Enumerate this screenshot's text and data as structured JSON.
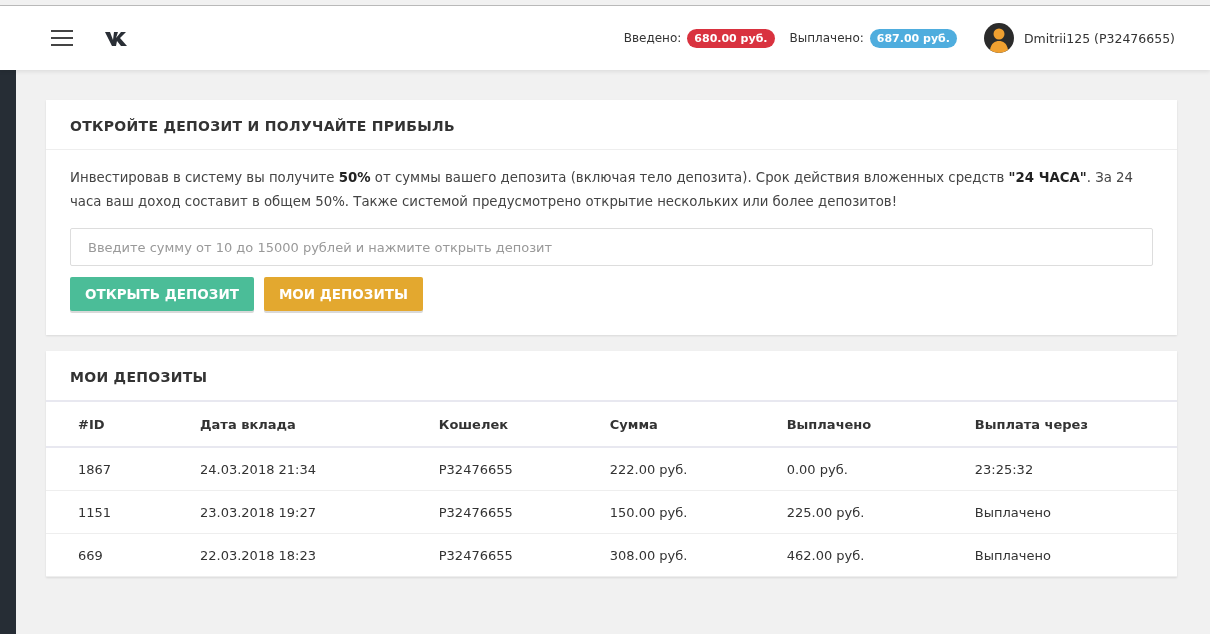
{
  "header": {
    "stats": [
      {
        "label": "Введено:",
        "value": "680.00 руб.",
        "color": "#d9323f"
      },
      {
        "label": "Выплачено:",
        "value": "687.00 руб.",
        "color": "#4fadde"
      }
    ],
    "user": "Dmitrii125 (P32476655)"
  },
  "deposit_panel": {
    "title": "ОТКРОЙТЕ ДЕПОЗИТ И ПОЛУЧАЙТЕ ПРИБЫЛЬ",
    "text": "Инвестировав в систему вы получите **50%** от суммы вашего депозита (включая тело депозита). Срок действия вложенных средств **\"24 ЧАСА\"**. За 24 часа ваш доход составит в общем 50%. Также системой предусмотрено открытие нескольких или более депозитов!",
    "input": {
      "placeholder": "Введите сумму от 10 до 15000 рублей и нажмите открыть депозит"
    },
    "buttons": [
      {
        "label": "ОТКРЫТЬ ДЕПОЗИТ",
        "color": "#4bbd98"
      },
      {
        "label": "МОИ ДЕПОЗИТЫ",
        "color": "#e3a82f"
      }
    ]
  },
  "deposits": {
    "title": "МОИ ДЕПОЗИТЫ",
    "columns": [
      "#ID",
      "Дата вклада",
      "Кошелек",
      "Сумма",
      "Выплачено",
      "Выплата через"
    ],
    "rows": [
      [
        "1867",
        "24.03.2018 21:34",
        "P32476655",
        "222.00 руб.",
        "0.00 руб.",
        "23:25:32"
      ],
      [
        "1151",
        "23.03.2018 19:27",
        "P32476655",
        "150.00 руб.",
        "225.00 руб.",
        "Выплачено"
      ],
      [
        "669",
        "22.03.2018 18:23",
        "P32476655",
        "308.00 руб.",
        "462.00 руб.",
        "Выплачено"
      ]
    ]
  }
}
